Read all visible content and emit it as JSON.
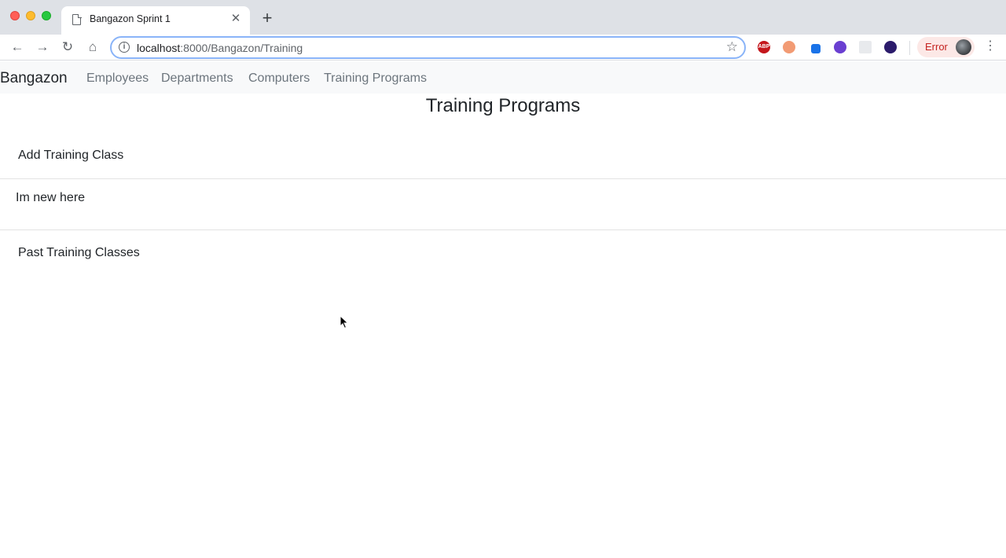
{
  "browser": {
    "tab_title": "Bangazon Sprint 1",
    "url_host": "localhost",
    "url_rest": ":8000/Bangazon/Training",
    "error_label": "Error",
    "extensions": [
      {
        "name": "adblock-icon",
        "label": "ABP",
        "color": "#c4161c"
      },
      {
        "name": "orange-extension-icon",
        "label": "",
        "color": "#f29b74"
      },
      {
        "name": "eyedropper-extension-icon",
        "label": "",
        "color": "#1a73e8"
      },
      {
        "name": "purple-cube-extension-icon",
        "label": "",
        "color": "#6a3fd1"
      },
      {
        "name": "grey-extension-icon",
        "label": "",
        "color": "#e8eaed"
      },
      {
        "name": "dark-extension-icon",
        "label": "",
        "color": "#2b1b6b"
      }
    ]
  },
  "navbar": {
    "brand": "Bangazon",
    "links": [
      "Employees",
      "Departments",
      "Computers",
      "Training Programs"
    ]
  },
  "main": {
    "title": "Training Programs",
    "add_link": "Add Training Class",
    "programs": [
      "Im new here"
    ],
    "past_link": "Past Training Classes"
  }
}
